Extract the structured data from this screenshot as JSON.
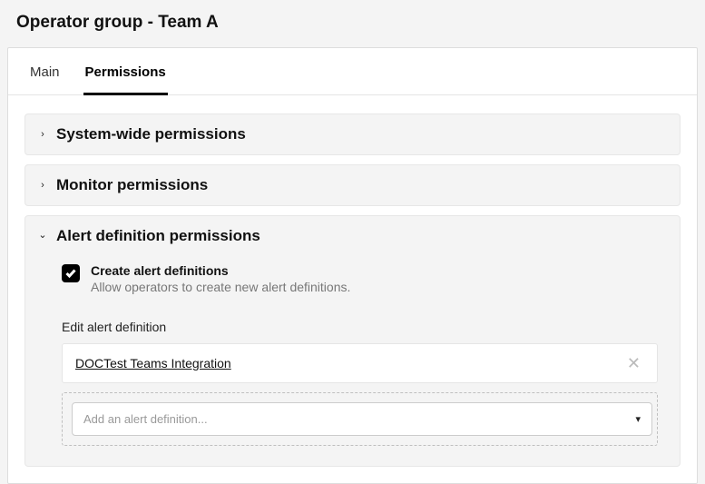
{
  "header": {
    "title": "Operator group - Team A"
  },
  "tabs": [
    {
      "label": "Main",
      "active": false
    },
    {
      "label": "Permissions",
      "active": true
    }
  ],
  "sections": {
    "system_wide": {
      "title": "System-wide permissions",
      "expanded": false
    },
    "monitor": {
      "title": "Monitor permissions",
      "expanded": false
    },
    "alert": {
      "title": "Alert definition permissions",
      "expanded": true,
      "create_checkbox": {
        "checked": true,
        "label": "Create alert definitions",
        "description": "Allow operators to create new alert definitions."
      },
      "edit_field": {
        "label": "Edit alert definition",
        "items": [
          {
            "name": "DOCTest Teams Integration"
          }
        ],
        "add_placeholder": "Add an alert definition..."
      }
    }
  }
}
